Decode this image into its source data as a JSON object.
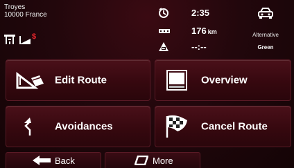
{
  "location": {
    "city": "Troyes",
    "zip_country": "10000 France"
  },
  "stats": {
    "time": "2:35",
    "distance_value": "176",
    "distance_unit": "km",
    "eta": "--:--"
  },
  "route": {
    "type": "Alternative",
    "mode": "Green"
  },
  "buttons": {
    "edit_route": "Edit Route",
    "overview": "Overview",
    "avoidances": "Avoidances",
    "cancel_route": "Cancel Route"
  },
  "bottom": {
    "back": "Back",
    "more": "More"
  },
  "icons": {
    "road": "highway-icon",
    "toll": "toll-road-icon",
    "time": "clock-icon",
    "distance": "distance-icon",
    "eta": "eta-flag-icon",
    "vehicle": "car-icon",
    "edit": "ruler-triangle-icon",
    "overview": "overview-icon",
    "avoid": "detour-arrow-icon",
    "cancel": "checkered-flag-icon",
    "back": "back-arrow-icon",
    "more": "more-icon"
  },
  "colors": {
    "accent_toll": "#e3242b",
    "background": "#22070c"
  }
}
